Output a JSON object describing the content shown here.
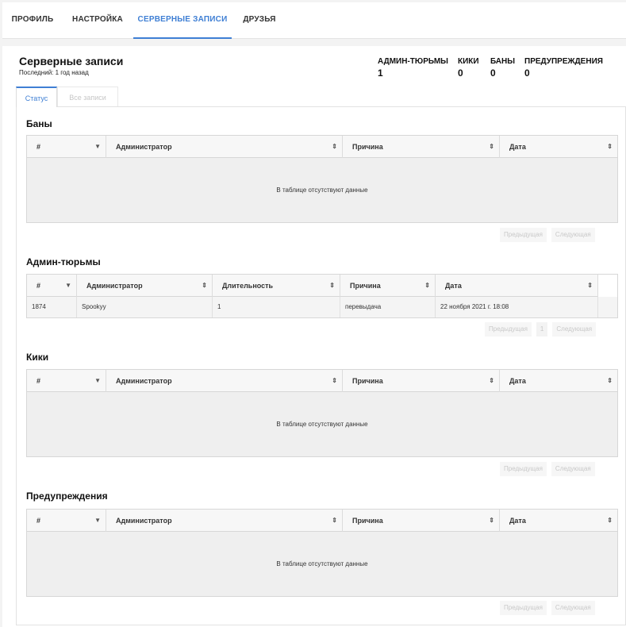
{
  "nav": {
    "tabs": [
      {
        "label": "Профиль"
      },
      {
        "label": "Настройка"
      },
      {
        "label": "Серверные записи"
      },
      {
        "label": "Друзья"
      }
    ],
    "active_index": 2
  },
  "header": {
    "title": "Серверные записи",
    "subtitle": "Последний: 1 год назад"
  },
  "stats": [
    {
      "label": "Админ-тюрьмы",
      "value": "1"
    },
    {
      "label": "Кики",
      "value": "0"
    },
    {
      "label": "Баны",
      "value": "0"
    },
    {
      "label": "Предупреждения",
      "value": "0"
    }
  ],
  "subtabs": [
    {
      "label": "Статус"
    },
    {
      "label": "Все записи"
    }
  ],
  "sections": {
    "bans": {
      "title": "Баны",
      "columns": [
        "#",
        "Администратор",
        "Причина",
        "Дата"
      ],
      "empty": "В таблице отсутствуют данные",
      "prev": "Предыдущая",
      "next": "Следующая"
    },
    "jails": {
      "title": "Админ-тюрьмы",
      "columns": [
        "#",
        "Администратор",
        "Длительность",
        "Причина",
        "Дата"
      ],
      "rows": [
        [
          "1874",
          "Spookyy",
          "1",
          "перевыдача",
          "22 ноября 2021 г. 18:08"
        ]
      ],
      "prev": "Предыдущая",
      "page": "1",
      "next": "Следующая"
    },
    "kicks": {
      "title": "Кики",
      "columns": [
        "#",
        "Администратор",
        "Причина",
        "Дата"
      ],
      "empty": "В таблице отсутствуют данные",
      "prev": "Предыдущая",
      "next": "Следующая"
    },
    "warnings": {
      "title": "Предупреждения",
      "columns": [
        "#",
        "Администратор",
        "Причина",
        "Дата"
      ],
      "empty": "В таблице отсутствуют данные",
      "prev": "Предыдущая",
      "next": "Следующая"
    }
  },
  "colors": {
    "accent": "#3f7fd4"
  }
}
